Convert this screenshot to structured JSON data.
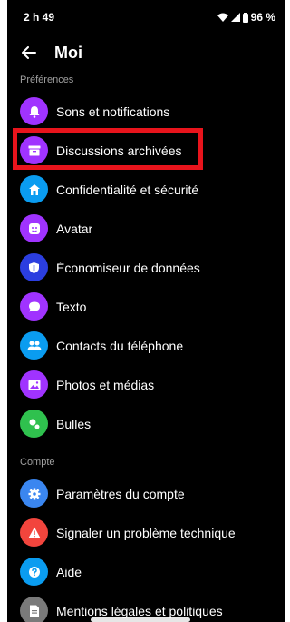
{
  "status_bar": {
    "time": "2 h 49",
    "battery": "96 %"
  },
  "header": {
    "title": "Moi",
    "back_icon": "arrow-left-icon"
  },
  "sections": {
    "preferences": "Préférences",
    "account": "Compte"
  },
  "items": [
    {
      "label": "Sons et notifications",
      "icon": "bell-icon",
      "color": "#a033ff"
    },
    {
      "label": "Discussions archivées",
      "icon": "archive-icon",
      "color": "#a033ff"
    },
    {
      "label": "Confidentialité et sécurité",
      "icon": "home-shield-icon",
      "color": "#0a9cf0"
    },
    {
      "label": "Avatar",
      "icon": "avatar-icon",
      "color": "#a033ff"
    },
    {
      "label": "Économiseur de données",
      "icon": "shield-icon",
      "color": "#2b3ee0"
    },
    {
      "label": "Texto",
      "icon": "chat-bubble-icon",
      "color": "#a033ff"
    },
    {
      "label": "Contacts du téléphone",
      "icon": "contacts-icon",
      "color": "#0a9cf0"
    },
    {
      "label": "Photos et médias",
      "icon": "photo-icon",
      "color": "#a033ff"
    },
    {
      "label": "Bulles",
      "icon": "bubbles-icon",
      "color": "#2fc14e"
    },
    {
      "label": "Paramètres du compte",
      "icon": "gear-icon",
      "color": "#3a86f0"
    },
    {
      "label": "Signaler un problème technique",
      "icon": "warning-icon",
      "color": "#f2453d"
    },
    {
      "label": "Aide",
      "icon": "help-icon",
      "color": "#0a9cf0"
    },
    {
      "label": "Mentions légales et politiques",
      "icon": "document-icon",
      "color": "#7a7a7a"
    }
  ],
  "highlight_color": "#e8141c"
}
